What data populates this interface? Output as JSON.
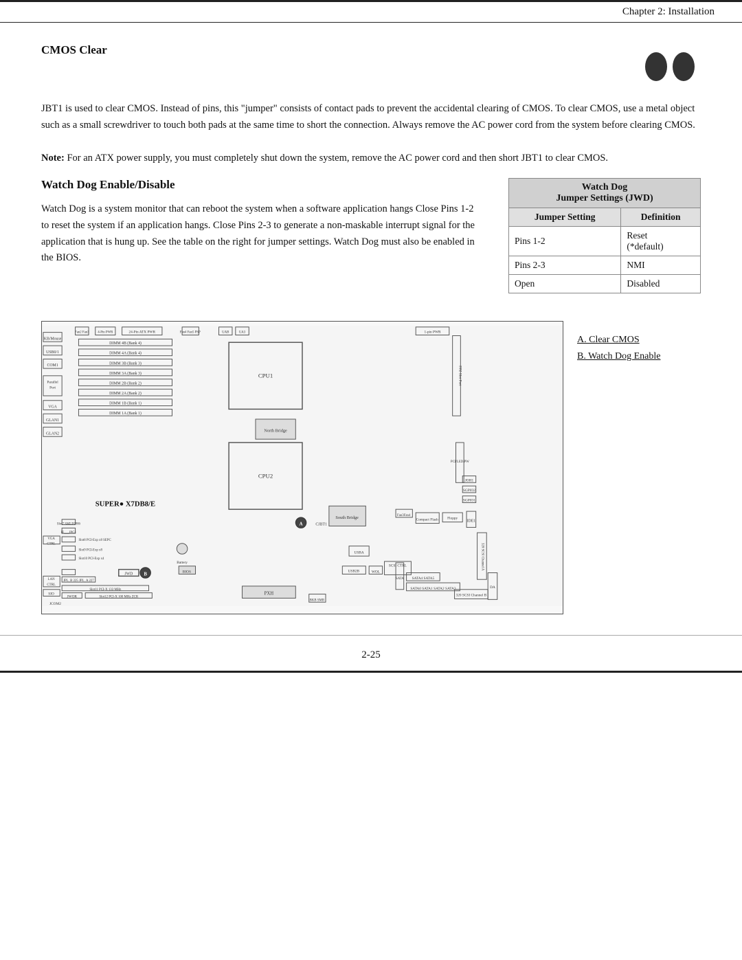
{
  "header": {
    "title": "Chapter 2: Installation"
  },
  "cmos_section": {
    "title": "CMOS Clear",
    "body1": "JBT1 is used to clear CMOS.  Instead of pins, this \"jumper\" consists of contact pads to prevent the accidental clearing of CMOS.  To clear CMOS, use a metal object such as a small screwdriver to touch both pads at the same time to short the connection. Always remove the AC power cord from the system before clearing CMOS.",
    "note_label": "Note:",
    "note_body": " For an ATX power supply, you must completely shut down the system, remove the AC power cord and then short JBT1 to clear CMOS."
  },
  "watchdog_section": {
    "title": "Watch Dog Enable/Disable",
    "body": "Watch Dog is a system monitor that can reboot the system when a software application hangs Close Pins 1-2 to  reset the system if an application hangs. Close Pins 2-3 to generate a non-maskable interrupt signal for the application that is hung up.  See the table on the right for jumper settings. Watch Dog must also be enabled in the BIOS.",
    "table": {
      "header_line1": "Watch Dog",
      "header_line2": "Jumper Settings (JWD)",
      "col1": "Jumper Setting",
      "col2": "Definition",
      "rows": [
        {
          "col1": "Pins 1-2",
          "col2": "Reset\n(*default)"
        },
        {
          "col1": "Pins 2-3",
          "col2": "NMI"
        },
        {
          "col1": "Open",
          "col2": "Disabled"
        }
      ]
    }
  },
  "diagram": {
    "label_a": "A. Clear CMOS",
    "label_b": "B. Watch Dog Enable",
    "board_name": "SUPER● X7DB8/E"
  },
  "footer": {
    "page_number": "2-25"
  }
}
